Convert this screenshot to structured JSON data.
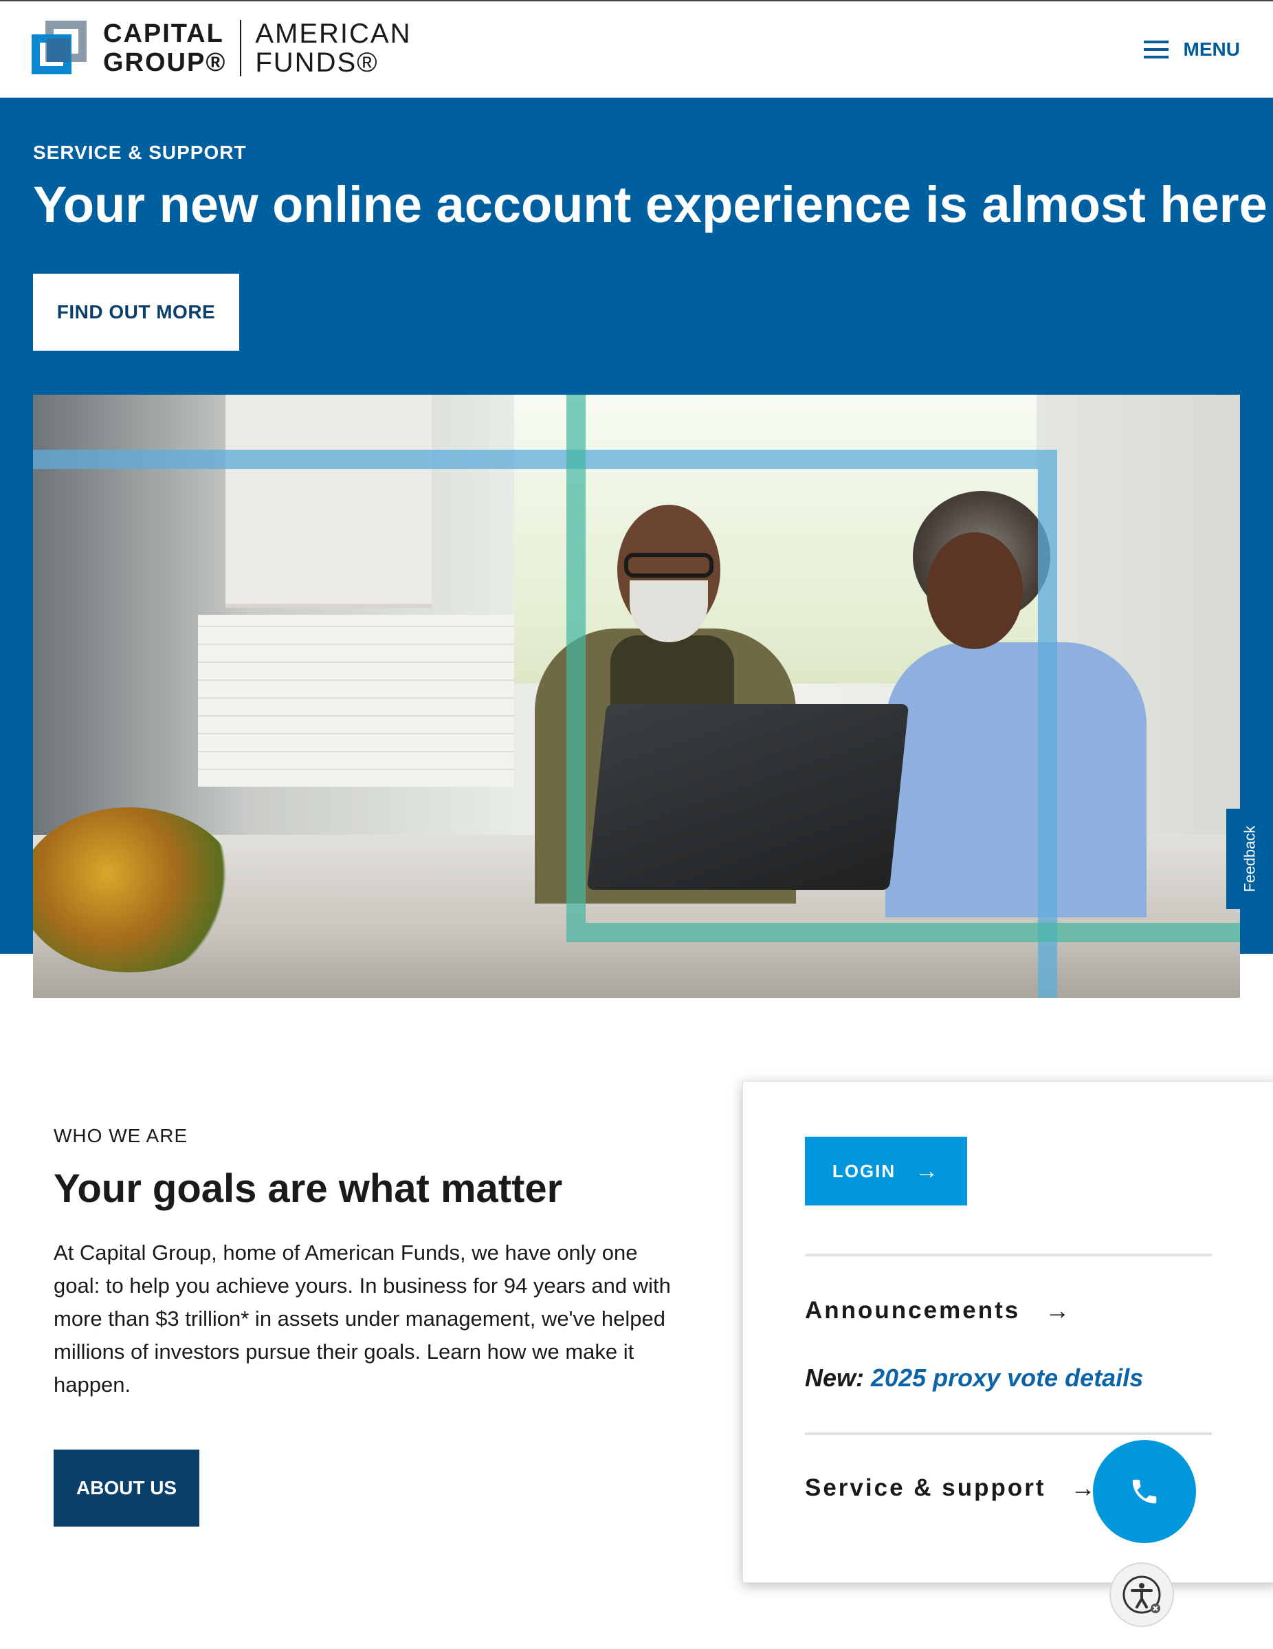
{
  "header": {
    "logo_line1": "CAPITAL",
    "logo_line2": "GROUP®",
    "logo_line3": "AMERICAN",
    "logo_line4": "FUNDS®",
    "menu_label": "MENU"
  },
  "hero": {
    "eyebrow": "SERVICE & SUPPORT",
    "title": "Your new online account experience is almost here",
    "cta_label": "FIND OUT MORE"
  },
  "feedback_label": "Feedback",
  "who": {
    "eyebrow": "WHO WE ARE",
    "title": "Your goals are what matter",
    "body": "At Capital Group, home of American Funds, we have only one goal: to help you achieve yours. In business for 94 years and with more than $3 trillion* in assets under management, we've helped millions of investors pursue their goals. Learn how we make it happen.",
    "cta_label": "ABOUT US"
  },
  "card": {
    "login_label": "LOGIN",
    "announcements_label": "Announcements",
    "new_prefix": "New:",
    "new_link": "2025 proxy vote details",
    "service_label": "Service & support"
  },
  "colors": {
    "brand_blue": "#005f9f",
    "navy": "#0a3e6b",
    "accent": "#0097dd",
    "link": "#0b64a8"
  },
  "icons": [
    "hamburger-menu-icon",
    "arrow-right-icon",
    "phone-icon",
    "accessibility-icon"
  ]
}
